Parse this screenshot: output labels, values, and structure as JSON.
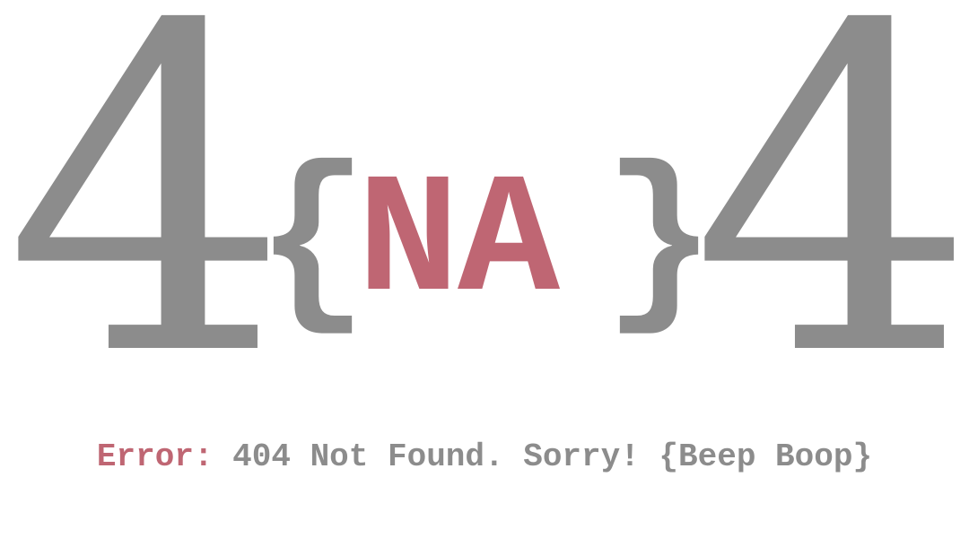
{
  "hero": {
    "left_digit": "4",
    "right_digit": "4",
    "brace_open": "{",
    "brace_close": "}",
    "center_text": "NA"
  },
  "message": {
    "label": "Error:",
    "text": "404 Not Found. Sorry! {Beep Boop}"
  },
  "colors": {
    "gray": "#8c8c8c",
    "accent": "#bf6673",
    "background": "#ffffff"
  }
}
